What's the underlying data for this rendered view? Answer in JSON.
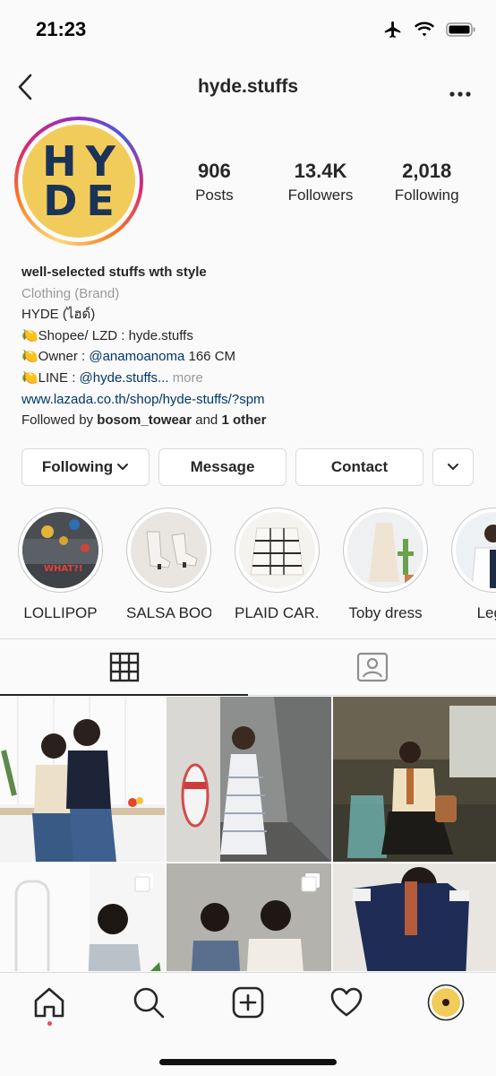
{
  "status_bar": {
    "time": "21:23"
  },
  "nav": {
    "username": "hyde.stuffs"
  },
  "profile": {
    "logo_lines": [
      "HY",
      "DE"
    ],
    "colors": {
      "logo_bg": "#f2cc5b",
      "logo_text": "#1b3357"
    },
    "stats": [
      {
        "value": "906",
        "label": "Posts"
      },
      {
        "value": "13.4K",
        "label": "Followers"
      },
      {
        "value": "2,018",
        "label": "Following"
      }
    ],
    "bio": {
      "name": "well-selected stuffs wth style",
      "category": "Clothing (Brand)",
      "line1": "HYDE (ไฮด์)",
      "line2": "🍋Shopee/ LZD : hyde.stuffs",
      "line3_prefix": "🍋Owner : ",
      "line3_mention": "@anamoanoma",
      "line3_suffix": " 166 CM",
      "line4_prefix": "🍋LINE : ",
      "line4_mention": "@hyde.stuffs...",
      "line4_more": " more",
      "website": "www.lazada.co.th/shop/hyde-stuffs/?spm",
      "followed_prefix": "Followed by ",
      "followed_user": "bosom_towear",
      "followed_mid": " and ",
      "followed_other": "1 other"
    }
  },
  "buttons": {
    "following": "Following",
    "message": "Message",
    "contact": "Contact"
  },
  "highlights": [
    {
      "label": "LOLLIPOP"
    },
    {
      "label": "SALSA BOO..."
    },
    {
      "label": "PLAID CAR..."
    },
    {
      "label": "Toby dress"
    },
    {
      "label": "Lego"
    }
  ],
  "highlight_pics": {
    "lollipop_caption": "WHAT?!"
  },
  "tabs": [
    "grid",
    "tagged"
  ],
  "bottom_nav": [
    "home",
    "search",
    "new-post",
    "activity",
    "profile"
  ]
}
